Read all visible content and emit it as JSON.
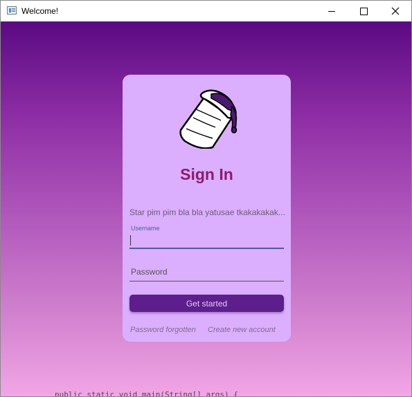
{
  "window": {
    "title": "Welcome!",
    "controls": {
      "minimize": "minimize-icon",
      "maximize": "maximize-icon",
      "close": "close-icon"
    }
  },
  "background_code_peek": "public static void main(String[] args) {",
  "login": {
    "logo_icon": "cup-icon",
    "heading": "Sign In",
    "description": "Star pim pim bla bla yatusae tkakakakak...",
    "username": {
      "label": "Username",
      "value": ""
    },
    "password": {
      "placeholder": "Password",
      "value": ""
    },
    "submit_label": "Get started",
    "forgot_label": "Password forgotten",
    "create_label": "Create new account"
  },
  "colors": {
    "gradient_top": "#5b0a82",
    "gradient_bottom": "#f2a6e6",
    "card": "#dcaefe",
    "heading": "#8b1c6e",
    "button": "#5c1f8c",
    "button_text": "#e6c8ff",
    "active_underline": "#4a5aa8"
  }
}
